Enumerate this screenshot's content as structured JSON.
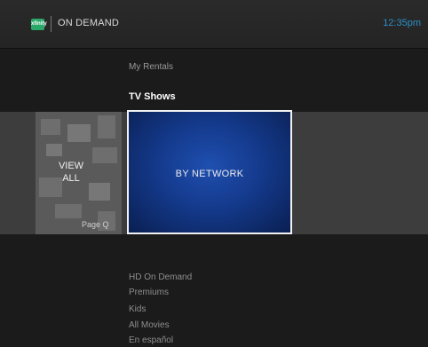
{
  "header": {
    "logo_text": "xfinity",
    "title": "ON DEMAND",
    "time": "12:35pm",
    "colors": {
      "logo": "#2aa86a",
      "time": "#2c8fc9"
    }
  },
  "menu_above": [
    {
      "label": "My Rentals"
    },
    {
      "label": "TV Shows"
    }
  ],
  "carousel": {
    "view_all": {
      "label_line1": "VIEW",
      "label_line2": "ALL",
      "page_indicator": "Page Q"
    },
    "selected": {
      "label": "BY NETWORK",
      "color": "#143a8c"
    }
  },
  "menu_below": [
    {
      "label": "HD On Demand"
    },
    {
      "label": "Premiums"
    },
    {
      "label": "Kids"
    },
    {
      "label": "All Movies"
    },
    {
      "label": "En español"
    }
  ]
}
